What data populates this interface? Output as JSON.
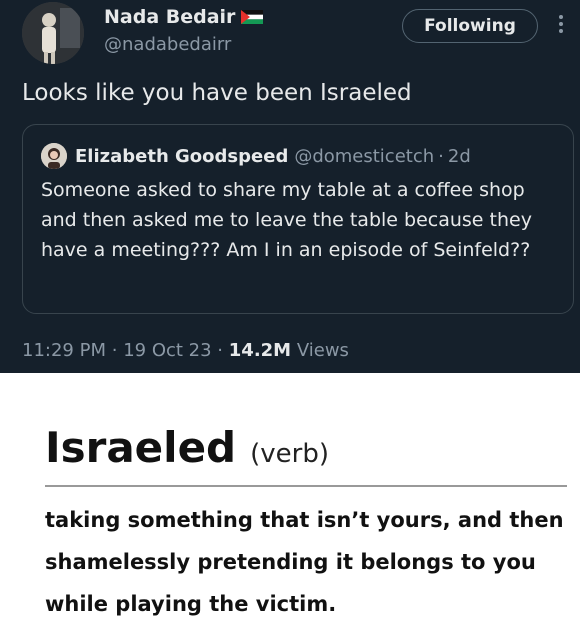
{
  "tweet": {
    "author_name": "Nada Bedair",
    "author_handle": "@nadabedairr",
    "follow_label": "Following",
    "text": "Looks like you have been Israeled",
    "time": "11:29 PM",
    "date": "19 Oct 23",
    "views_count": "14.2M",
    "views_label": "Views",
    "separator": "·",
    "icons": [
      "palestine-flag-icon",
      "more-options-icon"
    ]
  },
  "quote": {
    "author_name": "Elizabeth Goodspeed",
    "author_handle": "@domesticetch",
    "time": "2d",
    "separator": "·",
    "text": "Someone asked to share my table at a coffee shop and then asked me to leave the table because they have a meeting??? Am I in an episode of Seinfeld??"
  },
  "definition": {
    "term": "Israeled",
    "part_of_speech": "(verb)",
    "text": "taking something that isn’t yours, and then shamelessly pretending it belongs to you while playing the victim."
  },
  "colors": {
    "background_dark": "#15202b",
    "text_primary": "#e7e9ea",
    "text_secondary": "#8b98a5",
    "border": "#38444d"
  }
}
